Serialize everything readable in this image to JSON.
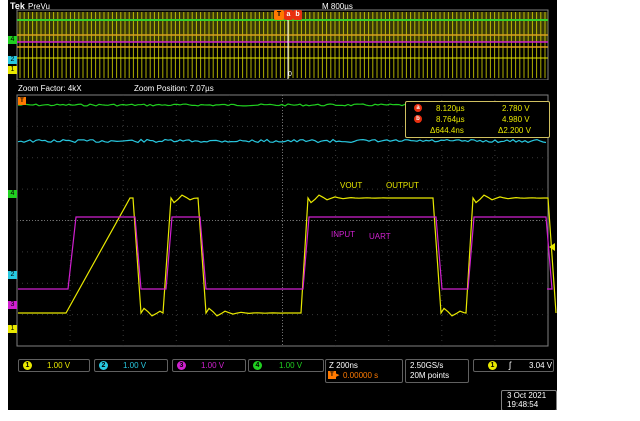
{
  "header": {
    "logo": "Tek",
    "mode": "PreVu",
    "timebase": "M 800µs",
    "trigger_marker": "T"
  },
  "zoom": {
    "factor": "Zoom Factor: 4kX",
    "position": "Zoom Position: 7.07µs"
  },
  "cursors": {
    "a_label": "a",
    "b_label": "b",
    "a_time": "8.120µs",
    "a_volt": "2.780 V",
    "b_time": "8.764µs",
    "b_volt": "4.980 V",
    "delta_time": "Δ644.4ns",
    "delta_volt": "Δ2.200 V"
  },
  "annotations": {
    "vout": "VOUT",
    "output": "OUTPUT",
    "input": "INPUT",
    "uart": "UART"
  },
  "overview_zero_label": "0",
  "channel_markers": [
    "1",
    "2",
    "3",
    "4"
  ],
  "channels": [
    {
      "num": "1",
      "scale": "1.00 V",
      "color": "#e8e800"
    },
    {
      "num": "2",
      "scale": "1.00 V",
      "color": "#28c8e0"
    },
    {
      "num": "3",
      "scale": "1.00 V",
      "color": "#d020d0"
    },
    {
      "num": "4",
      "scale": "1.00 V",
      "color": "#20d020"
    }
  ],
  "horizontal": {
    "scale": "Z 200ns",
    "delay": "0.00000 s"
  },
  "acquisition": {
    "rate": "2.50GS/s",
    "points": "20M points"
  },
  "trigger": {
    "source": "1",
    "level": "3.04 V"
  },
  "datetime": {
    "date": "3 Oct 2021",
    "time": "19:48:54"
  },
  "colors": {
    "ch1": "#e8e800",
    "ch2": "#28c8e0",
    "ch3": "#d020d0",
    "ch4": "#20d020",
    "trigger": "#ff7a00",
    "cursor": "#e83010",
    "grid": "#707070"
  }
}
